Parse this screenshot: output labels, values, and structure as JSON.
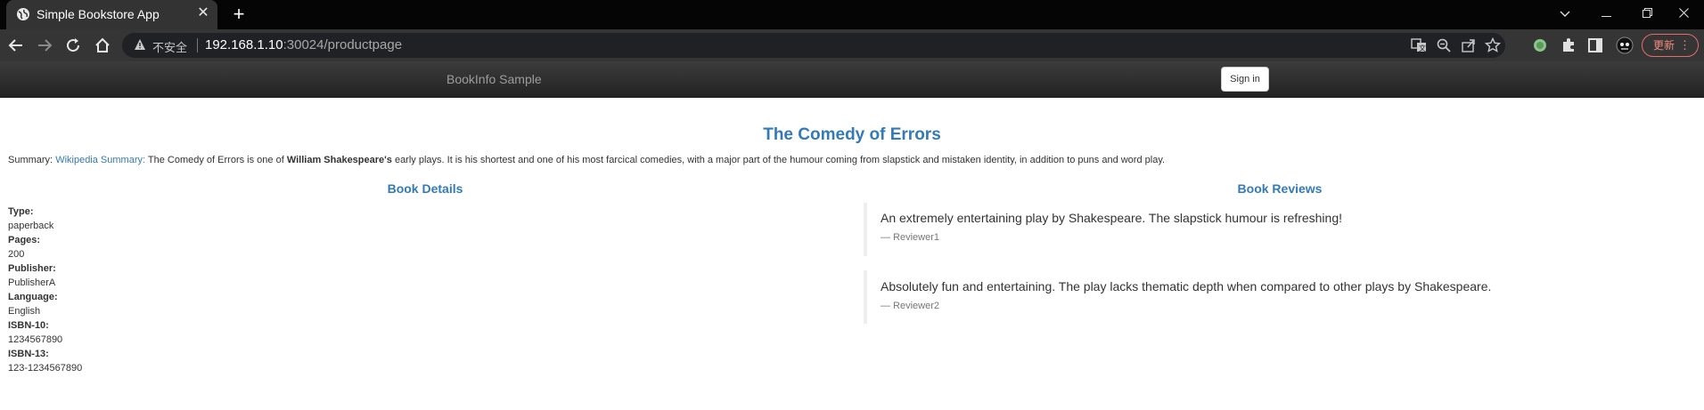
{
  "browser": {
    "tab_title": "Simple Bookstore App",
    "tab_close": "✕",
    "new_tab": "+",
    "security_label": "不安全",
    "url_host": "192.168.1.10",
    "url_path": ":30024/productpage",
    "update_label": "更新",
    "update_menu": "⋮"
  },
  "app": {
    "brand": "BookInfo Sample",
    "sign_in": "Sign in"
  },
  "product": {
    "title": "The Comedy of Errors",
    "summary_prefix": "Summary: ",
    "summary_link": "Wikipedia Summary:",
    "summary_text_1": " The Comedy of Errors is one of ",
    "summary_author": "William Shakespeare's",
    "summary_text_2": " early plays. It is his shortest and one of his most farcical comedies, with a major part of the humour coming from slapstick and mistaken identity, in addition to puns and word play."
  },
  "details": {
    "heading": "Book Details",
    "type_label": "Type:",
    "type_value": "paperback",
    "pages_label": "Pages:",
    "pages_value": "200",
    "publisher_label": "Publisher:",
    "publisher_value": "PublisherA",
    "language_label": "Language:",
    "language_value": "English",
    "isbn10_label": "ISBN-10:",
    "isbn10_value": "1234567890",
    "isbn13_label": "ISBN-13:",
    "isbn13_value": "123-1234567890"
  },
  "reviews": {
    "heading": "Book Reviews",
    "items": [
      {
        "text": "An extremely entertaining play by Shakespeare. The slapstick humour is refreshing!",
        "author": "— Reviewer1"
      },
      {
        "text": "Absolutely fun and entertaining. The play lacks thematic depth when compared to other plays by Shakespeare.",
        "author": "— Reviewer2"
      }
    ]
  },
  "colors": {
    "link": "#337ab7",
    "navbar": "#222222",
    "update_accent": "#e46c6c"
  }
}
